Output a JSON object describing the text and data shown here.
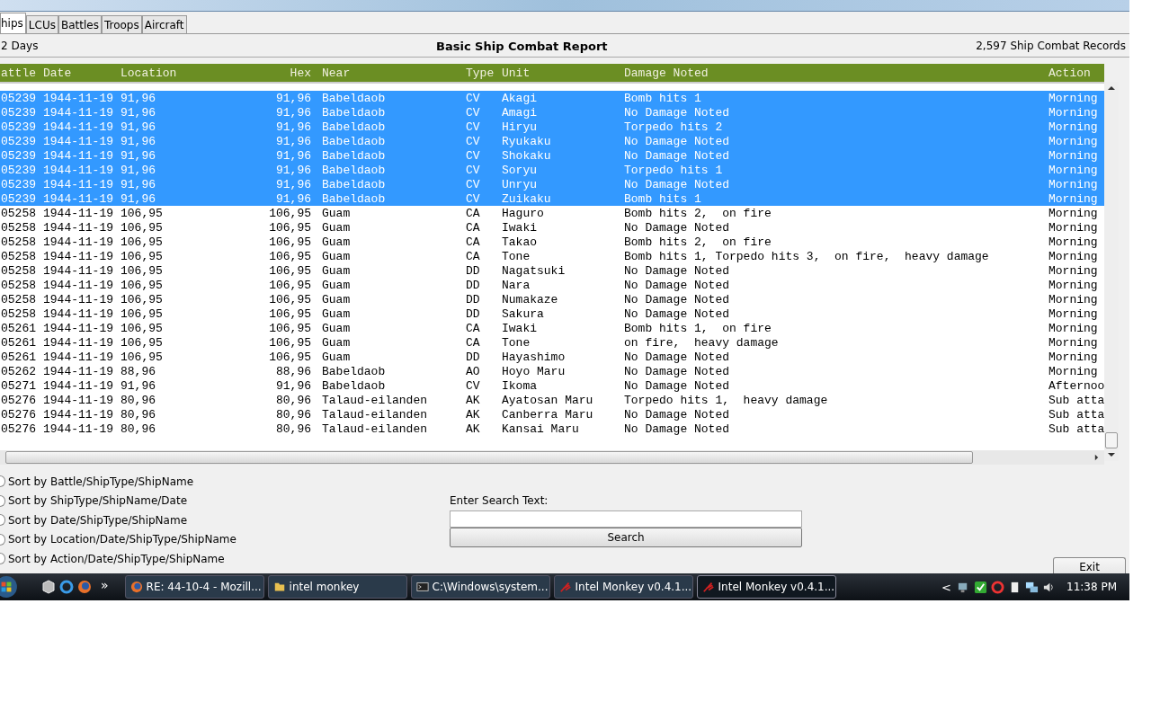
{
  "tabs": [
    {
      "label": "hips",
      "selected": true
    },
    {
      "label": "LCUs",
      "selected": false
    },
    {
      "label": "Battles",
      "selected": false
    },
    {
      "label": "Troops",
      "selected": false
    },
    {
      "label": "Aircraft",
      "selected": false
    }
  ],
  "report": {
    "period": "2 Days",
    "title": "Basic Ship Combat Report",
    "count": "2,597 Ship Combat Records"
  },
  "table": {
    "columns": [
      "attle",
      "Date",
      "Location",
      "Hex",
      "Near",
      "Type",
      "Unit",
      "Damage Noted",
      "Action"
    ],
    "rows": [
      {
        "selected": true,
        "cells": [
          "05239",
          "1944-11-19",
          "91,96",
          "91,96",
          "Babeldaob",
          "CV",
          "Akagi",
          "Bomb hits 1",
          "Morning"
        ]
      },
      {
        "selected": true,
        "cells": [
          "05239",
          "1944-11-19",
          "91,96",
          "91,96",
          "Babeldaob",
          "CV",
          "Amagi",
          "No Damage Noted",
          "Morning"
        ]
      },
      {
        "selected": true,
        "cells": [
          "05239",
          "1944-11-19",
          "91,96",
          "91,96",
          "Babeldaob",
          "CV",
          "Hiryu",
          "Torpedo hits 2",
          "Morning"
        ]
      },
      {
        "selected": true,
        "cells": [
          "05239",
          "1944-11-19",
          "91,96",
          "91,96",
          "Babeldaob",
          "CV",
          "Ryukaku",
          "No Damage Noted",
          "Morning"
        ]
      },
      {
        "selected": true,
        "cells": [
          "05239",
          "1944-11-19",
          "91,96",
          "91,96",
          "Babeldaob",
          "CV",
          "Shokaku",
          "No Damage Noted",
          "Morning"
        ]
      },
      {
        "selected": true,
        "cells": [
          "05239",
          "1944-11-19",
          "91,96",
          "91,96",
          "Babeldaob",
          "CV",
          "Soryu",
          "Torpedo hits 1",
          "Morning"
        ]
      },
      {
        "selected": true,
        "cells": [
          "05239",
          "1944-11-19",
          "91,96",
          "91,96",
          "Babeldaob",
          "CV",
          "Unryu",
          "No Damage Noted",
          "Morning"
        ]
      },
      {
        "selected": true,
        "cells": [
          "05239",
          "1944-11-19",
          "91,96",
          "91,96",
          "Babeldaob",
          "CV",
          "Zuikaku",
          "Bomb hits 1",
          "Morning"
        ]
      },
      {
        "selected": false,
        "cells": [
          "05258",
          "1944-11-19",
          "106,95",
          "106,95",
          "Guam",
          "CA",
          "Haguro",
          "Bomb hits 2,  on fire",
          "Morning"
        ]
      },
      {
        "selected": false,
        "cells": [
          "05258",
          "1944-11-19",
          "106,95",
          "106,95",
          "Guam",
          "CA",
          "Iwaki",
          "No Damage Noted",
          "Morning"
        ]
      },
      {
        "selected": false,
        "cells": [
          "05258",
          "1944-11-19",
          "106,95",
          "106,95",
          "Guam",
          "CA",
          "Takao",
          "Bomb hits 2,  on fire",
          "Morning"
        ]
      },
      {
        "selected": false,
        "cells": [
          "05258",
          "1944-11-19",
          "106,95",
          "106,95",
          "Guam",
          "CA",
          "Tone",
          "Bomb hits 1, Torpedo hits 3,  on fire,  heavy damage",
          "Morning"
        ]
      },
      {
        "selected": false,
        "cells": [
          "05258",
          "1944-11-19",
          "106,95",
          "106,95",
          "Guam",
          "DD",
          "Nagatsuki",
          "No Damage Noted",
          "Morning"
        ]
      },
      {
        "selected": false,
        "cells": [
          "05258",
          "1944-11-19",
          "106,95",
          "106,95",
          "Guam",
          "DD",
          "Nara",
          "No Damage Noted",
          "Morning"
        ]
      },
      {
        "selected": false,
        "cells": [
          "05258",
          "1944-11-19",
          "106,95",
          "106,95",
          "Guam",
          "DD",
          "Numakaze",
          "No Damage Noted",
          "Morning"
        ]
      },
      {
        "selected": false,
        "cells": [
          "05258",
          "1944-11-19",
          "106,95",
          "106,95",
          "Guam",
          "DD",
          "Sakura",
          "No Damage Noted",
          "Morning"
        ]
      },
      {
        "selected": false,
        "cells": [
          "05261",
          "1944-11-19",
          "106,95",
          "106,95",
          "Guam",
          "CA",
          "Iwaki",
          "Bomb hits 1,  on fire",
          "Morning"
        ]
      },
      {
        "selected": false,
        "cells": [
          "05261",
          "1944-11-19",
          "106,95",
          "106,95",
          "Guam",
          "CA",
          "Tone",
          "on fire,  heavy damage",
          "Morning"
        ]
      },
      {
        "selected": false,
        "cells": [
          "05261",
          "1944-11-19",
          "106,95",
          "106,95",
          "Guam",
          "DD",
          "Hayashimo",
          "No Damage Noted",
          "Morning"
        ]
      },
      {
        "selected": false,
        "cells": [
          "05262",
          "1944-11-19",
          "88,96",
          "88,96",
          "Babeldaob",
          "AO",
          "Hoyo Maru",
          "No Damage Noted",
          "Morning"
        ]
      },
      {
        "selected": false,
        "cells": [
          "05271",
          "1944-11-19",
          "91,96",
          "91,96",
          "Babeldaob",
          "CV",
          "Ikoma",
          "No Damage Noted",
          "Afternoo"
        ]
      },
      {
        "selected": false,
        "cells": [
          "05276",
          "1944-11-19",
          "80,96",
          "80,96",
          "Talaud-eilanden",
          "AK",
          "Ayatosan Maru",
          "Torpedo hits 1,  heavy damage",
          "Sub atta"
        ]
      },
      {
        "selected": false,
        "cells": [
          "05276",
          "1944-11-19",
          "80,96",
          "80,96",
          "Talaud-eilanden",
          "AK",
          "Canberra Maru",
          "No Damage Noted",
          "Sub atta"
        ]
      },
      {
        "selected": false,
        "cells": [
          "05276",
          "1944-11-19",
          "80,96",
          "80,96",
          "Talaud-eilanden",
          "AK",
          "Kansai Maru",
          "No Damage Noted",
          "Sub atta"
        ]
      }
    ]
  },
  "sort_options": [
    {
      "label": "Sort by Battle/ShipType/ShipName",
      "selected": false
    },
    {
      "label": "Sort by ShipType/ShipName/Date",
      "selected": false
    },
    {
      "label": "Sort by Date/ShipType/ShipName",
      "selected": false
    },
    {
      "label": "Sort by Location/Date/ShipType/ShipName",
      "selected": false
    },
    {
      "label": "Sort by Action/Date/ShipType/ShipName",
      "selected": false
    }
  ],
  "search": {
    "label": "Enter Search Text:",
    "button": "Search"
  },
  "exit_button": "Exit",
  "taskbar": {
    "quick_launch": "»",
    "tasks": [
      {
        "label": "RE: 44-10-4 - Mozill...",
        "kind": "browser",
        "selected": false
      },
      {
        "label": "intel monkey",
        "kind": "folder",
        "selected": false
      },
      {
        "label": "C:\\Windows\\system...",
        "kind": "console",
        "selected": false
      },
      {
        "label": "Intel Monkey v0.4.1...",
        "kind": "app",
        "selected": false
      },
      {
        "label": "Intel Monkey v0.4.1...",
        "kind": "app",
        "selected": true
      }
    ],
    "tray_arrow": "<",
    "clock": "11:38 PM"
  }
}
